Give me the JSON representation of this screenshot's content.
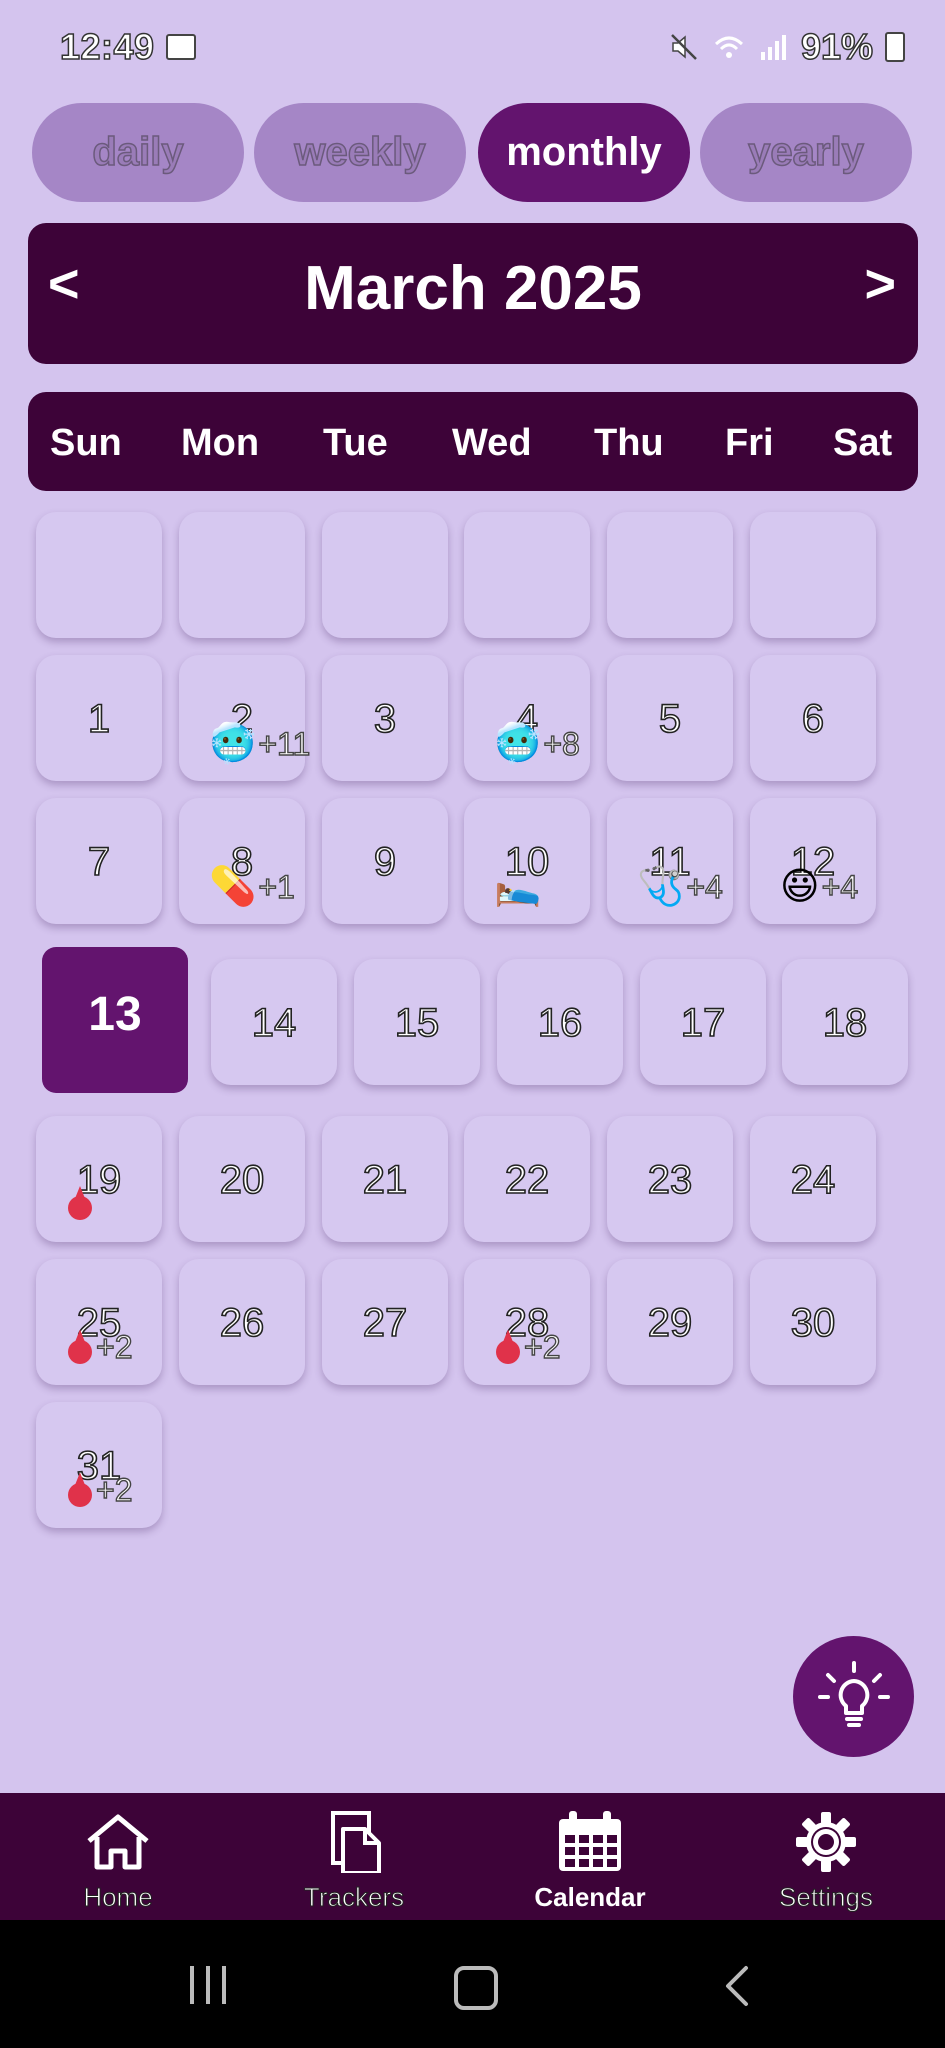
{
  "status_bar": {
    "time": "12:49",
    "battery": "91%"
  },
  "tabs": [
    {
      "label": "daily",
      "active": false
    },
    {
      "label": "weekly",
      "active": false
    },
    {
      "label": "monthly",
      "active": true
    },
    {
      "label": "yearly",
      "active": false
    }
  ],
  "calendar": {
    "title": "March 2025",
    "prev": "<",
    "next": ">",
    "weekdays": [
      "Sun",
      "Mon",
      "Tue",
      "Wed",
      "Thu",
      "Fri",
      "Sat"
    ],
    "days": [
      {
        "day": "1"
      },
      {
        "day": "2",
        "icon": "🥶",
        "more": "+11"
      },
      {
        "day": "3"
      },
      {
        "day": "4",
        "icon": "🥶",
        "more": "+8"
      },
      {
        "day": "5"
      },
      {
        "day": "6"
      },
      {
        "day": "7"
      },
      {
        "day": "8",
        "icon": "💊",
        "more": "+1"
      },
      {
        "day": "9"
      },
      {
        "day": "10",
        "icon": "🛌"
      },
      {
        "day": "11",
        "icon": "🩺",
        "more": "+4"
      },
      {
        "day": "12",
        "icon": "😃",
        "more": "+4"
      },
      {
        "day": "13",
        "today": true
      },
      {
        "day": "14"
      },
      {
        "day": "15"
      },
      {
        "day": "16"
      },
      {
        "day": "17"
      },
      {
        "day": "18"
      },
      {
        "day": "19",
        "icon": "drop"
      },
      {
        "day": "20"
      },
      {
        "day": "21"
      },
      {
        "day": "22"
      },
      {
        "day": "23"
      },
      {
        "day": "24"
      },
      {
        "day": "25",
        "icon": "drop",
        "more": "+2"
      },
      {
        "day": "26"
      },
      {
        "day": "27"
      },
      {
        "day": "28",
        "icon": "drop",
        "more": "+2"
      },
      {
        "day": "29"
      },
      {
        "day": "30"
      },
      {
        "day": "31",
        "icon": "drop",
        "more": "+2"
      }
    ]
  },
  "bottom_nav": [
    {
      "label": "Home",
      "icon": "home-icon",
      "active": false
    },
    {
      "label": "Trackers",
      "icon": "trackers-icon",
      "active": false
    },
    {
      "label": "Calendar",
      "icon": "calendar-icon",
      "active": true
    },
    {
      "label": "Settings",
      "icon": "gear-icon",
      "active": false
    }
  ],
  "colors": {
    "background": "#d4c4ee",
    "primary": "#3d0338",
    "accent": "#63146e"
  }
}
